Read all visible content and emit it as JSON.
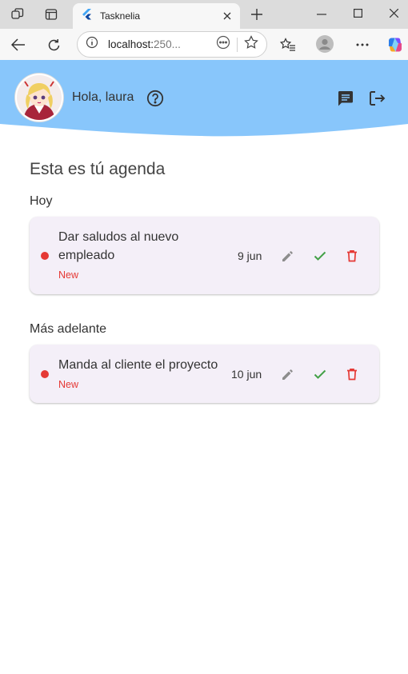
{
  "browser": {
    "tab_title": "Tasknelia",
    "url_main": "localhost:",
    "url_rest": "250..."
  },
  "header": {
    "greeting": "Hola, laura",
    "accent_color": "#88c6fb"
  },
  "agenda": {
    "title": "Esta es tú agenda",
    "sections": [
      {
        "label": "Hoy",
        "tasks": [
          {
            "title": "Dar saludos al nuevo empleado",
            "title_line1": "Dar saludos al nuevo",
            "title_line2": "empleado",
            "status": "New",
            "date": "9 jun"
          }
        ]
      },
      {
        "label": "Más adelante",
        "tasks": [
          {
            "title": "Manda al cliente el proyecto",
            "status": "New",
            "date": "10 jun"
          }
        ]
      }
    ]
  },
  "colors": {
    "status_new": "#e53935",
    "card_bg": "#f4eff8",
    "complete": "#43a047",
    "delete": "#e53935"
  }
}
